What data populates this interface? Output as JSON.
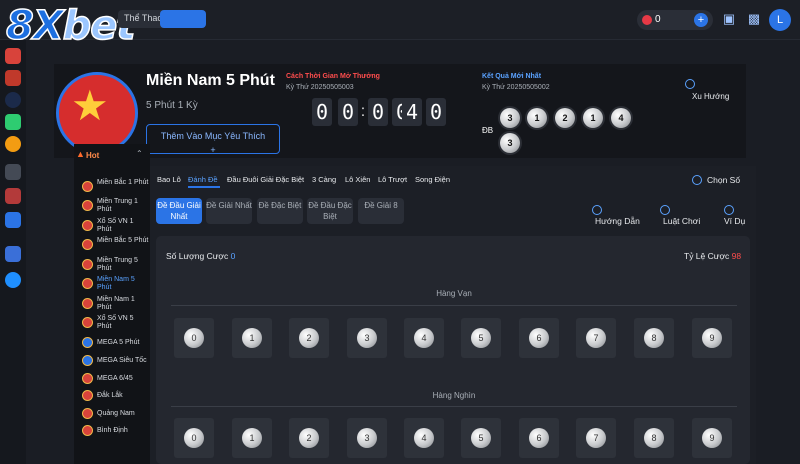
{
  "brand": {
    "logo_main": "8X",
    "logo_accent": "bet"
  },
  "topnav": {
    "tab_sport": "Thể Thao",
    "balance": "0",
    "avatar_letter": "L"
  },
  "game": {
    "title": "Miền Nam 5 Phút",
    "subtitle": "5 Phút 1 Kỳ",
    "favorite_button": "Thêm Vào Mục Yêu Thích",
    "favorite_plus": "+"
  },
  "countdown": {
    "label": "Cách Thời Gian Mở Thưởng",
    "period": "Kỳ Thứ 20250505003",
    "digits": [
      "0",
      "0",
      "0",
      "0",
      "4",
      "0"
    ],
    "separator": ":"
  },
  "result": {
    "label": "Kết Quả Mới Nhất",
    "period": "Kỳ Thứ 20250505002",
    "db_label": "ĐB",
    "balls": [
      "3",
      "1",
      "2",
      "1",
      "4",
      "3"
    ],
    "trend_label": "Xu Hướng"
  },
  "sidebar": {
    "hot_label": "Hot",
    "items": [
      {
        "label": "Miền Bắc 1 Phút"
      },
      {
        "label": "Miền Trung 1 Phút"
      },
      {
        "label": "Xổ Số VN 1 Phút"
      },
      {
        "label": "Miền Bắc 5 Phút"
      },
      {
        "label": "Miền Trung 5 Phút"
      },
      {
        "label": "Miền Nam 5 Phút"
      },
      {
        "label": "Miền Nam 1 Phút"
      },
      {
        "label": "Xổ Số VN 5 Phút"
      },
      {
        "label": "MEGA 5 Phút"
      },
      {
        "label": "MEGA Siêu Tốc"
      },
      {
        "label": "MEGA 6/45"
      },
      {
        "label": "Đắk Lắk"
      },
      {
        "label": "Quảng Nam"
      },
      {
        "label": "Bình Định"
      }
    ]
  },
  "bet_tabs": [
    "Bao Lô",
    "Đánh Đề",
    "Đầu Đuôi Giải Đặc Biệt",
    "3 Càng",
    "Lô Xiên",
    "Lô Trượt",
    "Song Điện"
  ],
  "choose_label": "Chọn Số",
  "sub_tabs": [
    "Đề Đầu Giải Nhất",
    "Đề Giải Nhất",
    "Đề Đặc Biệt",
    "Đề Đầu Đặc Biệt",
    "Đề Giải 8"
  ],
  "actions": {
    "guide": "Hướng Dẫn",
    "rules": "Luật Chơi",
    "example": "Ví Dụ"
  },
  "stats": {
    "count_label": "Số Lượng Cược",
    "count_value": "0",
    "rate_label": "Tỷ Lệ Cược",
    "rate_value": "98"
  },
  "rows": [
    {
      "title": "Hàng Vạn",
      "numbers": [
        "0",
        "1",
        "2",
        "3",
        "4",
        "5",
        "6",
        "7",
        "8",
        "9"
      ]
    },
    {
      "title": "Hàng Nghìn",
      "numbers": [
        "0",
        "1",
        "2",
        "3",
        "4",
        "5",
        "6",
        "7",
        "8",
        "9"
      ]
    }
  ]
}
